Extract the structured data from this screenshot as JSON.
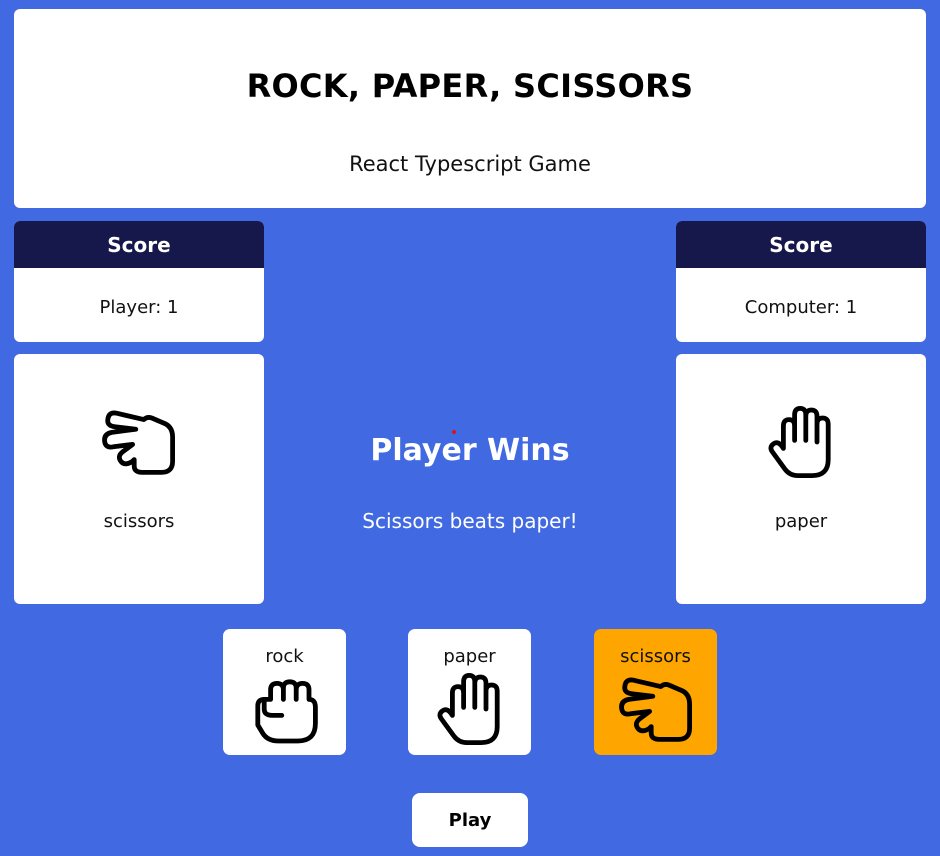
{
  "header": {
    "title": "ROCK, PAPER, SCISSORS",
    "subtitle": "React Typescript Game"
  },
  "player": {
    "score_heading": "Score",
    "score_text": "Player: 1",
    "choice_label": "scissors",
    "choice_icon": "scissors-hand-icon"
  },
  "computer": {
    "score_heading": "Score",
    "score_text": "Computer: 1",
    "choice_label": "paper",
    "choice_icon": "paper-hand-icon"
  },
  "result": {
    "title": "Player Wins",
    "message": "Scissors beats paper!"
  },
  "options": [
    {
      "label": "rock",
      "icon": "rock-fist-icon",
      "selected": false
    },
    {
      "label": "paper",
      "icon": "paper-hand-icon",
      "selected": false
    },
    {
      "label": "scissors",
      "icon": "scissors-hand-icon",
      "selected": true
    }
  ],
  "play_label": "Play",
  "colors": {
    "background": "#4169e1",
    "score_header": "#16174a",
    "selected_option": "#ffa500",
    "card": "#ffffff"
  }
}
